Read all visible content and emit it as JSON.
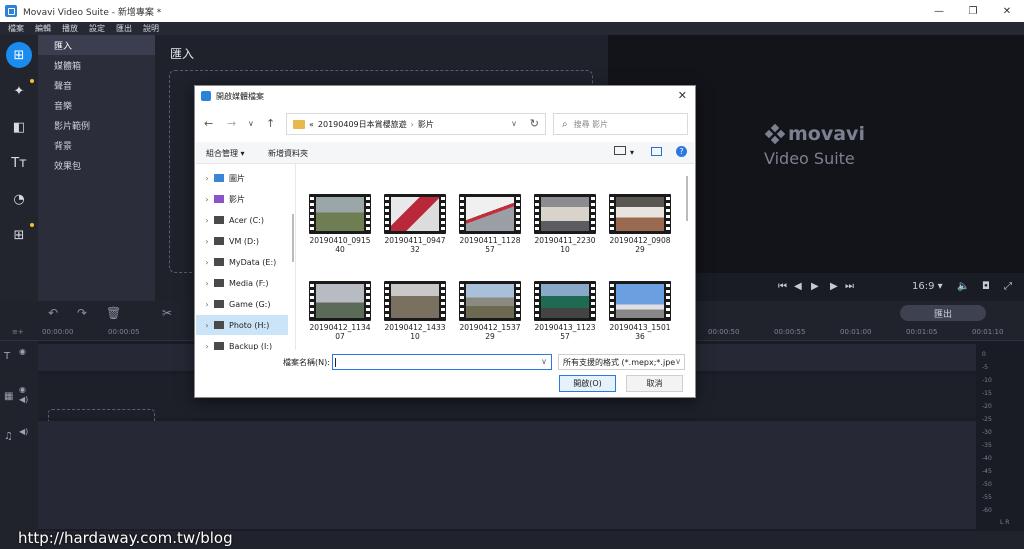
{
  "window": {
    "title": "Movavi Video Suite - 新增專案 *",
    "minimize": "—",
    "maximize": "❐",
    "close": "✕"
  },
  "menu": [
    "檔案",
    "編輯",
    "播放",
    "設定",
    "匯出",
    "說明"
  ],
  "left_rail": {
    "buttons": [
      {
        "name": "import-icon",
        "glyph": "⊞",
        "active": true,
        "dot": false
      },
      {
        "name": "magic-wand-icon",
        "glyph": "✦",
        "active": false,
        "dot": true
      },
      {
        "name": "transitions-icon",
        "glyph": "◧",
        "active": false,
        "dot": false
      },
      {
        "name": "titles-icon",
        "glyph": "Tт",
        "active": false,
        "dot": false
      },
      {
        "name": "stickers-icon",
        "glyph": "◔",
        "active": false,
        "dot": false
      },
      {
        "name": "more-tools-icon",
        "glyph": "⊞",
        "active": false,
        "dot": true
      }
    ]
  },
  "side_panel": {
    "items": [
      "匯入",
      "媒體箱",
      "聲音",
      "音樂",
      "影片範例",
      "背景",
      "效果包"
    ],
    "active_index": 0
  },
  "import": {
    "title": "匯入"
  },
  "preview": {
    "brand_name": "movavi",
    "brand_sub": "Video Suite",
    "aspect": "16:9 ▾"
  },
  "timeline": {
    "export_label": "匯出",
    "ruler": [
      "00:00:00",
      "00:00:05",
      "00:00:50",
      "00:00:55",
      "00:01:00",
      "00:01:05",
      "00:01:10"
    ],
    "meter_labels": [
      "0",
      "-5",
      "-10",
      "-15",
      "-20",
      "-25",
      "-30",
      "-35",
      "-40",
      "-45",
      "-50",
      "-55",
      "-60"
    ],
    "meter_lr": "L R"
  },
  "watermark": "http://hardaway.com.tw/blog",
  "dialog": {
    "title": "開啟媒體檔案",
    "close": "✕",
    "nav": {
      "back": "←",
      "forward": "→",
      "down": "∨",
      "up": "↑"
    },
    "path": {
      "prefix": "«",
      "folder": "20190409日本賞櫻旅遊",
      "separator": "›",
      "subfolder": "影片",
      "dropdown": "∨",
      "refresh": "↻"
    },
    "search_placeholder": "搜尋 影片",
    "commands": {
      "organize": "組合管理 ▾",
      "new_folder": "新增資料夾",
      "view_dropdown": "▾",
      "help": "?"
    },
    "tree": [
      {
        "label": "圖片",
        "icon": "pictures-icon",
        "color": "#3a86d4",
        "selected": false
      },
      {
        "label": "影片",
        "icon": "videos-icon",
        "color": "#8a55c8",
        "selected": false
      },
      {
        "label": "Acer (C:)",
        "icon": "drive-icon",
        "color": "#4a4a4a",
        "selected": false
      },
      {
        "label": "VM (D:)",
        "icon": "drive-icon",
        "color": "#4a4a4a",
        "selected": false
      },
      {
        "label": "MyData (E:)",
        "icon": "drive-icon",
        "color": "#4a4a4a",
        "selected": false
      },
      {
        "label": "Media (F:)",
        "icon": "drive-icon",
        "color": "#4a4a4a",
        "selected": false
      },
      {
        "label": "Game (G:)",
        "icon": "drive-icon",
        "color": "#4a4a4a",
        "selected": false
      },
      {
        "label": "Photo (H:)",
        "icon": "drive-icon",
        "color": "#4a4a4a",
        "selected": true
      },
      {
        "label": "Backup (I:)",
        "icon": "drive-icon",
        "color": "#4a4a4a",
        "selected": false
      }
    ],
    "files": [
      {
        "line1": "20190410_0915",
        "line2": "40",
        "scene": "field"
      },
      {
        "line1": "20190411_0947",
        "line2": "32",
        "scene": "train-red"
      },
      {
        "line1": "20190411_1128",
        "line2": "57",
        "scene": "train-white"
      },
      {
        "line1": "20190411_2230",
        "line2": "10",
        "scene": "station"
      },
      {
        "line1": "20190412_0908",
        "line2": "29",
        "scene": "platform"
      },
      {
        "line1": "20190412_1134",
        "line2": "07",
        "scene": "cloudy"
      },
      {
        "line1": "20190412_1433",
        "line2": "10",
        "scene": "town"
      },
      {
        "line1": "20190412_1537",
        "line2": "29",
        "scene": "mountain"
      },
      {
        "line1": "20190413_1123",
        "line2": "57",
        "scene": "train-green"
      },
      {
        "line1": "20190413_1501",
        "line2": "36",
        "scene": "sky"
      }
    ],
    "filename_label": "檔案名稱(N):",
    "filename_value": "",
    "filter_value": "所有支援的格式 (*.mepx;*.jpe",
    "dropdown": "∨",
    "open_label": "開啟(O)",
    "cancel_label": "取消"
  }
}
